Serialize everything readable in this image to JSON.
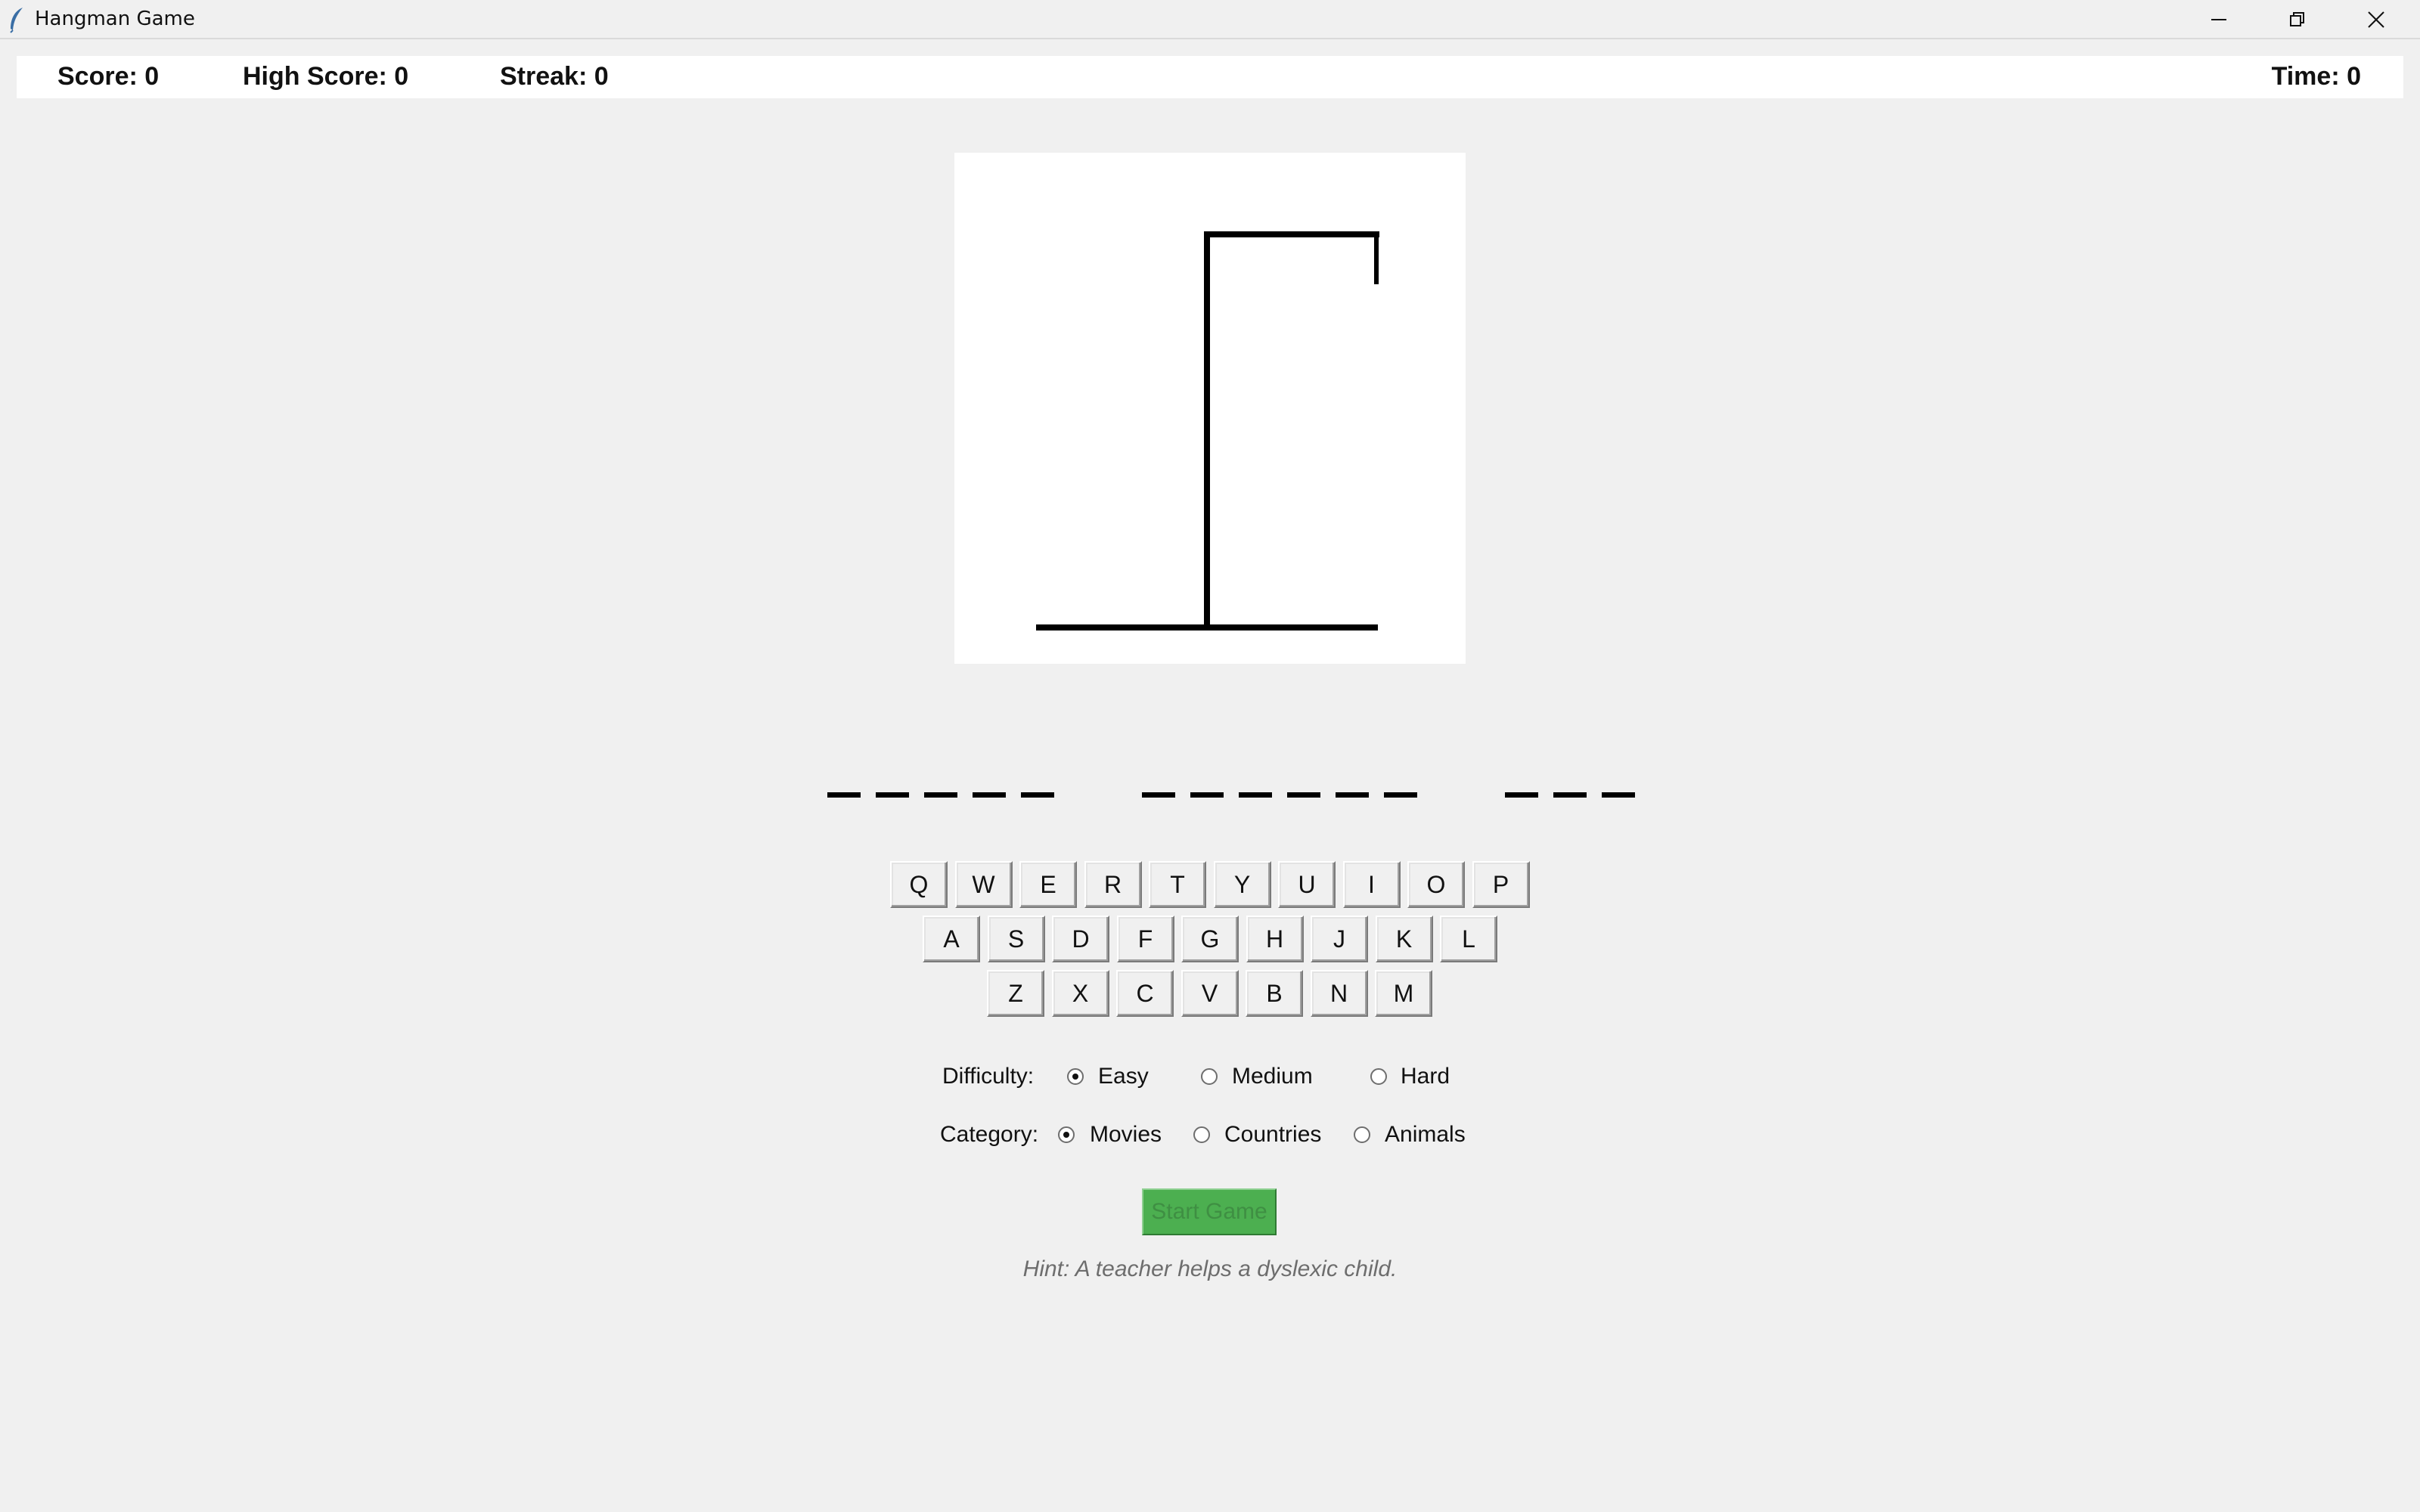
{
  "window": {
    "title": "Hangman Game",
    "icon": "feather-icon"
  },
  "status": {
    "score": "Score: 0",
    "high_score": "High Score: 0",
    "streak": "Streak: 0",
    "time": "Time: 0"
  },
  "word": {
    "groups": [
      5,
      6,
      3
    ]
  },
  "keyboard": {
    "row1": [
      "Q",
      "W",
      "E",
      "R",
      "T",
      "Y",
      "U",
      "I",
      "O",
      "P"
    ],
    "row2": [
      "A",
      "S",
      "D",
      "F",
      "G",
      "H",
      "J",
      "K",
      "L"
    ],
    "row3": [
      "Z",
      "X",
      "C",
      "V",
      "B",
      "N",
      "M"
    ]
  },
  "difficulty": {
    "label": "Difficulty:",
    "options": [
      "Easy",
      "Medium",
      "Hard"
    ],
    "selected": "Easy"
  },
  "category": {
    "label": "Category:",
    "options": [
      "Movies",
      "Countries",
      "Animals"
    ],
    "selected": "Movies"
  },
  "start_button": "Start Game",
  "hint": "Hint: A teacher helps a dyslexic child.",
  "colors": {
    "background": "#f0f0f0",
    "start_button": "#4caf50",
    "hint_text": "#6d6d6d"
  }
}
